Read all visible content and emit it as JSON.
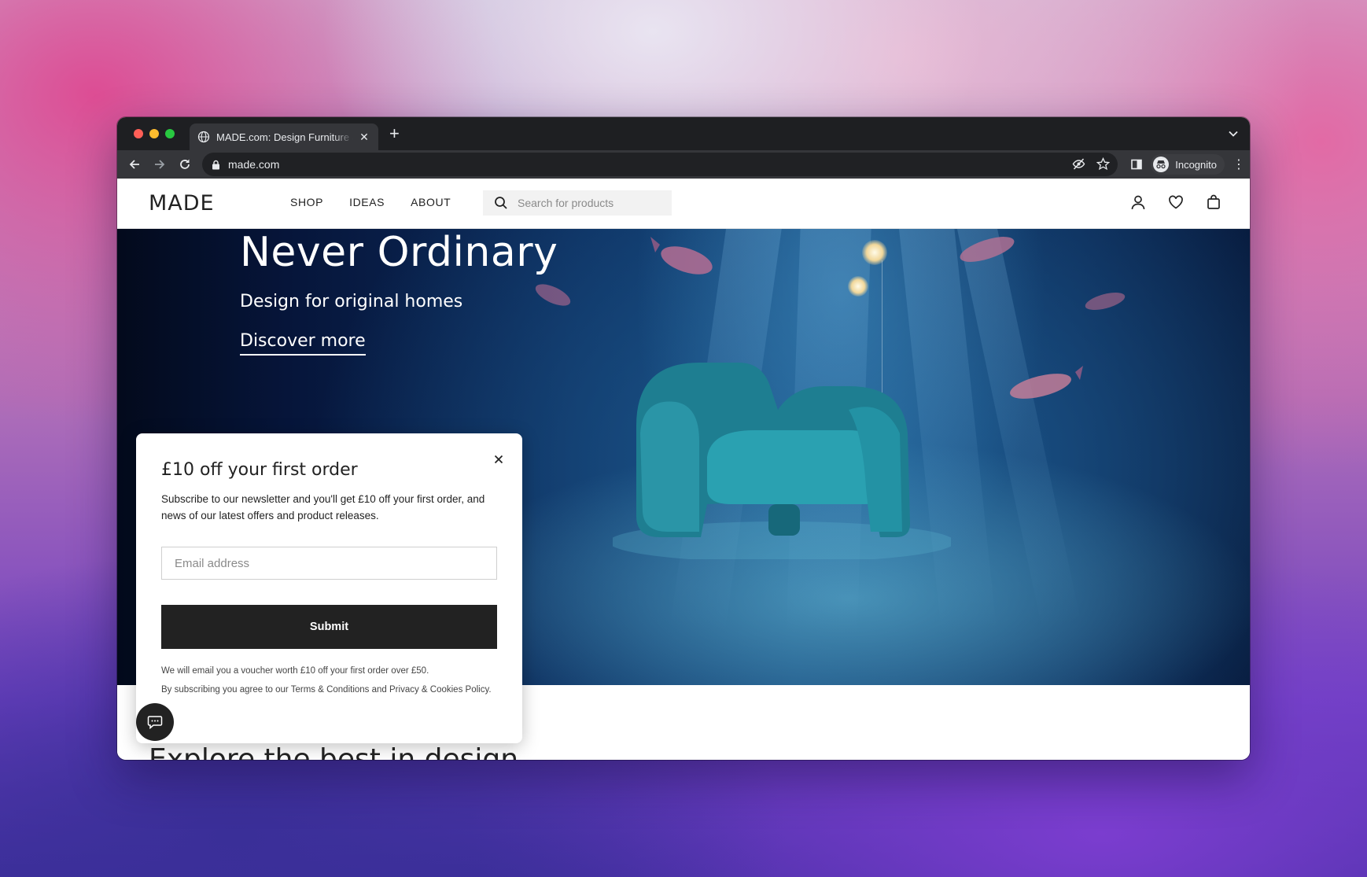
{
  "browser": {
    "tab_title": "MADE.com: Design Furniture & Homewares",
    "new_tab": "+",
    "tab_close": "✕",
    "url": "made.com",
    "profile_label": "Incognito"
  },
  "site": {
    "logo": "MADE",
    "nav": [
      "SHOP",
      "IDEAS",
      "ABOUT"
    ],
    "search_placeholder": "Search for products"
  },
  "hero": {
    "title": "Never Ordinary",
    "subtitle": "Design for original homes",
    "cta": "Discover more"
  },
  "popup": {
    "title": "£10 off your first order",
    "body": "Subscribe to our newsletter and you'll get £10 off your first order, and news of our latest offers and product releases.",
    "email_placeholder": "Email address",
    "submit_label": "Submit",
    "legal_line1": "We will email you a voucher worth £10 off your first order over £50.",
    "legal_prefix": "By subscribing you agree to our ",
    "terms_link": "Terms & Conditions",
    "legal_and": " and ",
    "privacy_link": "Privacy & Cookies Policy",
    "legal_end": "."
  },
  "below": {
    "section_title": "Explore the best in design"
  },
  "colors": {
    "primary": "#222222",
    "hero_bg": "#0f3a6e",
    "chrome_dark": "#35363a"
  }
}
